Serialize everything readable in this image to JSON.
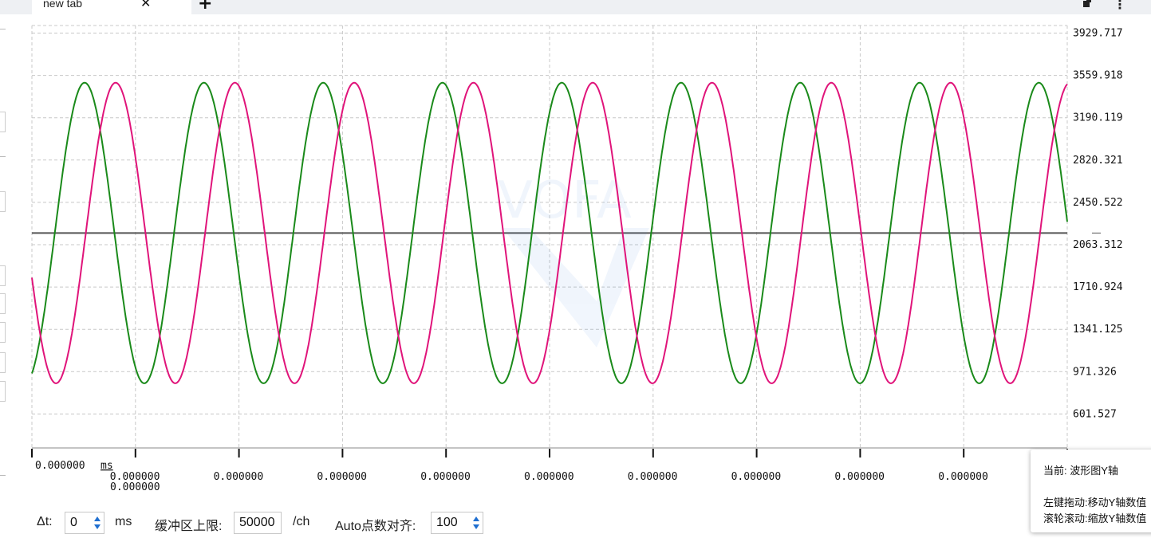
{
  "tab": {
    "title": "new tab",
    "close_icon": "close-icon",
    "new_tab_icon": "plus-icon"
  },
  "chart_data": {
    "type": "line",
    "title": "",
    "xlabel": "",
    "ylabel": "",
    "x_unit": "ms",
    "x_ticks": [
      "0.000000",
      "0.000000",
      "0.000000",
      "0.000000",
      "0.000000",
      "0.000000",
      "0.000000",
      "0.000000",
      "0.000000",
      "0.000000"
    ],
    "y_ticks": [
      "3929.717",
      "3559.918",
      "3190.119",
      "2820.321",
      "2450.522",
      "2063.312",
      "1710.924",
      "1341.125",
      "971.326",
      "601.527"
    ],
    "y_range": [
      231.7,
      4019
    ],
    "grid": true,
    "baseline_value": 2155,
    "series": [
      {
        "color": "#1a8a1a",
        "center": 2155,
        "amplitude": 1350,
        "cycles": 8.68,
        "phase_cycles": 0.808
      },
      {
        "color": "#e0147a",
        "center": 2155,
        "amplitude": 1350,
        "cycles": 8.68,
        "phase_cycles": 0.548
      }
    ]
  },
  "controls": {
    "dt_label": "Δt:",
    "dt_value": "0",
    "dt_unit": "ms",
    "buffer_label": "缓冲区上限:",
    "buffer_value": "50000",
    "buffer_unit": "/ch",
    "auto_label": "Auto点数对齐:",
    "auto_value": "100"
  },
  "tooltip": {
    "line1": "当前: 波形图Y轴",
    "line2": "左键拖动:移动Y轴数值",
    "line3": "滚轮滚动:缩放Y轴数值"
  },
  "colors": {
    "grid": "#c8c8c8",
    "baseline": "#555555",
    "spin_arrow": "#1f6fd0"
  }
}
